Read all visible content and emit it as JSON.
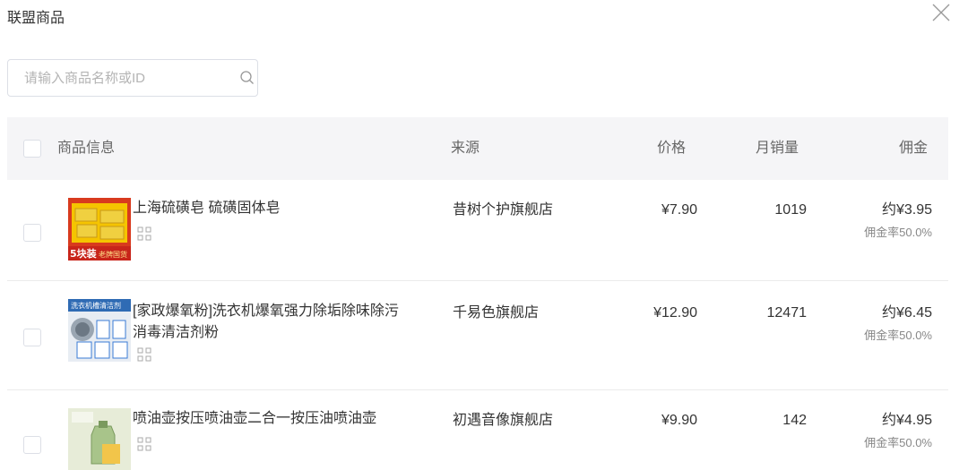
{
  "dialog": {
    "title": "联盟商品"
  },
  "search": {
    "placeholder": "请输入商品名称或ID"
  },
  "table": {
    "headers": {
      "info": "商品信息",
      "source": "来源",
      "price": "价格",
      "monthly_sales": "月销量",
      "commission": "佣金"
    },
    "rows": [
      {
        "name": "上海硫磺皂 硫磺固体皂",
        "source": "昔树个护旗舰店",
        "price": "¥7.90",
        "sales": "1019",
        "commission": "约¥3.95",
        "rate": "佣金率50.0%",
        "thumb_banner": "5块装",
        "thumb_banner2": "老牌国货"
      },
      {
        "name": "[家政爆氧粉]洗衣机爆氧强力除垢除味除污消毒清洁剂粉",
        "source": "千易色旗舰店",
        "price": "¥12.90",
        "sales": "12471",
        "commission": "约¥6.45",
        "rate": "佣金率50.0%",
        "thumb_banner": "洗衣机槽清洁剂"
      },
      {
        "name": "喷油壶按压喷油壶二合一按压油喷油壶",
        "source": "初遇音像旗舰店",
        "price": "¥9.90",
        "sales": "142",
        "commission": "约¥4.95",
        "rate": "佣金率50.0%"
      }
    ]
  }
}
